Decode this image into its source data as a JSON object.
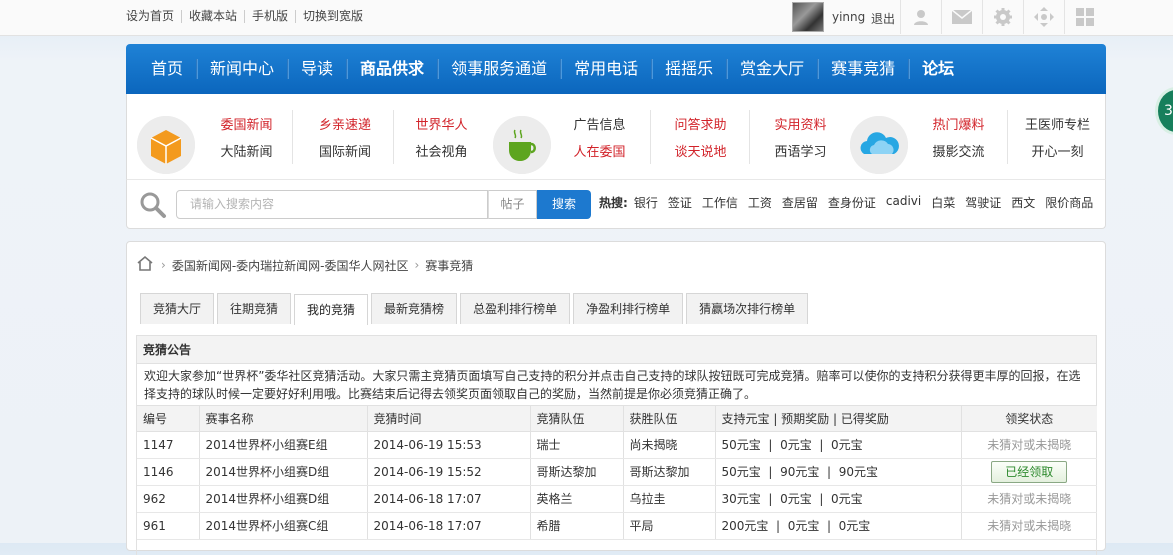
{
  "topbar": {
    "links": [
      "设为首页",
      "收藏本站",
      "手机版",
      "切换到宽版"
    ],
    "username": "yinng",
    "logout": "退出",
    "icons": [
      "user-icon",
      "mail-icon",
      "gear-icon",
      "move-icon",
      "grid-icon"
    ]
  },
  "nav": {
    "items": [
      {
        "label": "首页",
        "bold": false
      },
      {
        "label": "新闻中心",
        "bold": false
      },
      {
        "label": "导读",
        "bold": false
      },
      {
        "label": "商品供求",
        "bold": true
      },
      {
        "label": "领事服务通道",
        "bold": false
      },
      {
        "label": "常用电话",
        "bold": false
      },
      {
        "label": "摇摇乐",
        "bold": false
      },
      {
        "label": "赏金大厅",
        "bold": false
      },
      {
        "label": "赛事竞猜",
        "bold": false
      },
      {
        "label": "论坛",
        "bold": true
      }
    ]
  },
  "channels": {
    "groups": [
      {
        "top": "委国新闻",
        "bottom": "大陆新闻",
        "top_red": true,
        "bottom_red": false
      },
      {
        "top": "乡亲速递",
        "bottom": "国际新闻",
        "top_red": true,
        "bottom_red": false
      },
      {
        "top": "世界华人",
        "bottom": "社会视角",
        "top_red": true,
        "bottom_red": false
      },
      {
        "top": "广告信息",
        "bottom": "人在委国",
        "top_red": false,
        "bottom_red": true
      },
      {
        "top": "问答求助",
        "bottom": "谈天说地",
        "top_red": true,
        "bottom_red": true
      },
      {
        "top": "实用资料",
        "bottom": "西语学习",
        "top_red": true,
        "bottom_red": false
      },
      {
        "top": "热门爆料",
        "bottom": "摄影交流",
        "top_red": true,
        "bottom_red": false
      },
      {
        "top": "王医师专栏",
        "bottom": "开心一刻",
        "top_red": false,
        "bottom_red": false
      }
    ]
  },
  "search": {
    "placeholder": "请输入搜索内容",
    "type": "帖子",
    "button": "搜索",
    "hot_label": "热搜:",
    "hot_terms": [
      "银行",
      "签证",
      "工作信",
      "工资",
      "查居留",
      "查身份证",
      "cadivi",
      "白菜",
      "驾驶证",
      "西文",
      "限价商品"
    ]
  },
  "breadcrumb": {
    "site": "委国新闻网-委内瑞拉新闻网-委国华人网社区",
    "current": "赛事竞猜"
  },
  "tabs": [
    "竞猜大厅",
    "往期竞猜",
    "我的竞猜",
    "最新竞猜榜",
    "总盈利排行榜单",
    "净盈利排行榜单",
    "猜赢场次排行榜单"
  ],
  "active_tab": 2,
  "notice": {
    "title": "竞猜公告",
    "text": "欢迎大家参加“世界杯”委华社区竞猜活动。大家只需主竞猜页面填写自己支持的积分并点击自己支持的球队按钮既可完成竞猜。赔率可以使你的支持积分获得更丰厚的回报，在选择支持的球队时候一定要好好利用哦。比赛结束后记得去领奖页面领取自己的奖励，当然前提是你必须竞猜正确了。"
  },
  "table": {
    "headers": [
      "编号",
      "赛事名称",
      "竞猜时间",
      "竞猜队伍",
      "获胜队伍",
      "支持元宝 | 预期奖励 | 已得奖励",
      "领奖状态"
    ],
    "rows": [
      {
        "id": "1147",
        "match": "2014世界杯小组赛E组",
        "time": "2014-06-19 15:53",
        "team": "瑞士",
        "winner": "尚未揭晓",
        "support": "50元宝",
        "expected": "0元宝",
        "got": "0元宝",
        "status": "未猜对或未揭晓",
        "claimable": false
      },
      {
        "id": "1146",
        "match": "2014世界杯小组赛D组",
        "time": "2014-06-19 15:52",
        "team": "哥斯达黎加",
        "winner": "哥斯达黎加",
        "support": "50元宝",
        "expected": "90元宝",
        "got": "90元宝",
        "status": "已经领取",
        "claimable": true
      },
      {
        "id": "962",
        "match": "2014世界杯小组赛D组",
        "time": "2014-06-18 17:07",
        "team": "英格兰",
        "winner": "乌拉圭",
        "support": "30元宝",
        "expected": "0元宝",
        "got": "0元宝",
        "status": "未猜对或未揭晓",
        "claimable": false
      },
      {
        "id": "961",
        "match": "2014世界杯小组赛C组",
        "time": "2014-06-18 17:07",
        "team": "希腊",
        "winner": "平局",
        "support": "200元宝",
        "expected": "0元宝",
        "got": "0元宝",
        "status": "未猜对或未揭晓",
        "claimable": false
      }
    ]
  },
  "side_badge": "3",
  "colors": {
    "nav_blue": "#0b66bd",
    "accent_red": "#d2232a",
    "search_blue": "#1d79cf",
    "claim_green": "#2e8a2e"
  }
}
